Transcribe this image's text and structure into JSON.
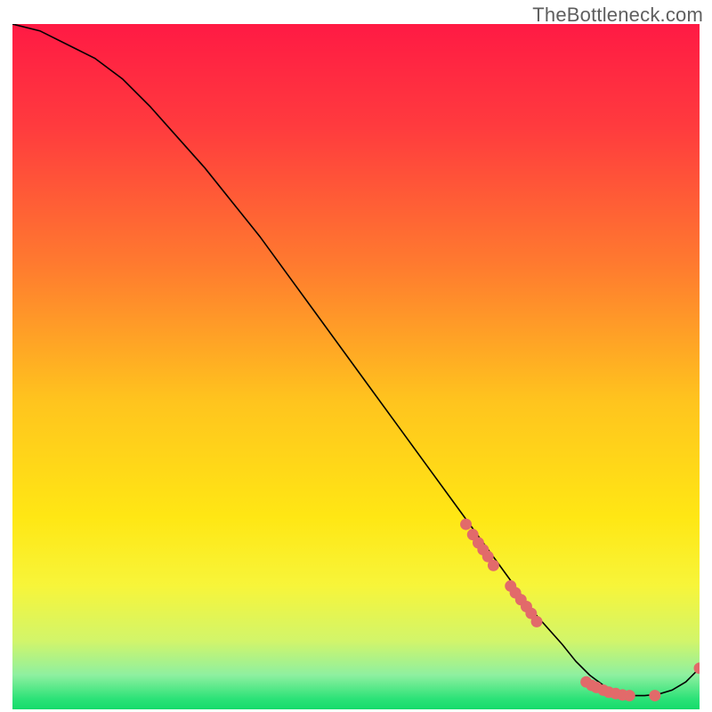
{
  "watermark": "TheBottleneck.com",
  "chart_data": {
    "type": "line",
    "title": "",
    "xlabel": "",
    "ylabel": "",
    "xlim": [
      0,
      100
    ],
    "ylim": [
      0,
      100
    ],
    "gradient_stops": [
      {
        "offset": 0.0,
        "color": "#ff1a44"
      },
      {
        "offset": 0.15,
        "color": "#ff3b3e"
      },
      {
        "offset": 0.35,
        "color": "#ff7a2f"
      },
      {
        "offset": 0.55,
        "color": "#ffc41e"
      },
      {
        "offset": 0.72,
        "color": "#ffe714"
      },
      {
        "offset": 0.82,
        "color": "#f7f53a"
      },
      {
        "offset": 0.9,
        "color": "#d2f56a"
      },
      {
        "offset": 0.95,
        "color": "#8ef0a0"
      },
      {
        "offset": 0.985,
        "color": "#2be277"
      },
      {
        "offset": 1.0,
        "color": "#16db6b"
      }
    ],
    "series": [
      {
        "name": "bottleneck-curve",
        "stroke": "#000000",
        "stroke_width": 1.6,
        "x": [
          0,
          4,
          8,
          12,
          16,
          20,
          24,
          28,
          32,
          36,
          40,
          44,
          48,
          52,
          56,
          60,
          64,
          68,
          72,
          76,
          80,
          82,
          84,
          86,
          88,
          90,
          92,
          94,
          96,
          98,
          100
        ],
        "y": [
          100,
          99,
          97,
          95,
          92,
          88,
          83.5,
          79,
          74,
          69,
          63.5,
          58,
          52.5,
          47,
          41.5,
          36,
          30.5,
          25,
          19.5,
          14,
          9.5,
          7,
          5,
          3.5,
          2.5,
          2,
          2,
          2.2,
          2.8,
          4,
          6
        ]
      }
    ],
    "points": {
      "name": "highlight-points",
      "fill": "#e26a6a",
      "stroke": "#e26a6a",
      "radius": 6,
      "data": [
        {
          "x": 66,
          "y": 27
        },
        {
          "x": 67,
          "y": 25.5
        },
        {
          "x": 67.8,
          "y": 24.3
        },
        {
          "x": 68.5,
          "y": 23.3
        },
        {
          "x": 69.2,
          "y": 22.3
        },
        {
          "x": 70,
          "y": 21
        },
        {
          "x": 72.5,
          "y": 18
        },
        {
          "x": 73.2,
          "y": 17
        },
        {
          "x": 74,
          "y": 16
        },
        {
          "x": 74.8,
          "y": 15
        },
        {
          "x": 75.5,
          "y": 14
        },
        {
          "x": 76.3,
          "y": 12.8
        },
        {
          "x": 83.5,
          "y": 4
        },
        {
          "x": 84.3,
          "y": 3.5
        },
        {
          "x": 85,
          "y": 3.2
        },
        {
          "x": 86,
          "y": 2.8
        },
        {
          "x": 86.8,
          "y": 2.5
        },
        {
          "x": 87.8,
          "y": 2.3
        },
        {
          "x": 88.8,
          "y": 2.1
        },
        {
          "x": 89.8,
          "y": 2
        },
        {
          "x": 93.5,
          "y": 2
        },
        {
          "x": 100,
          "y": 6
        }
      ]
    }
  }
}
